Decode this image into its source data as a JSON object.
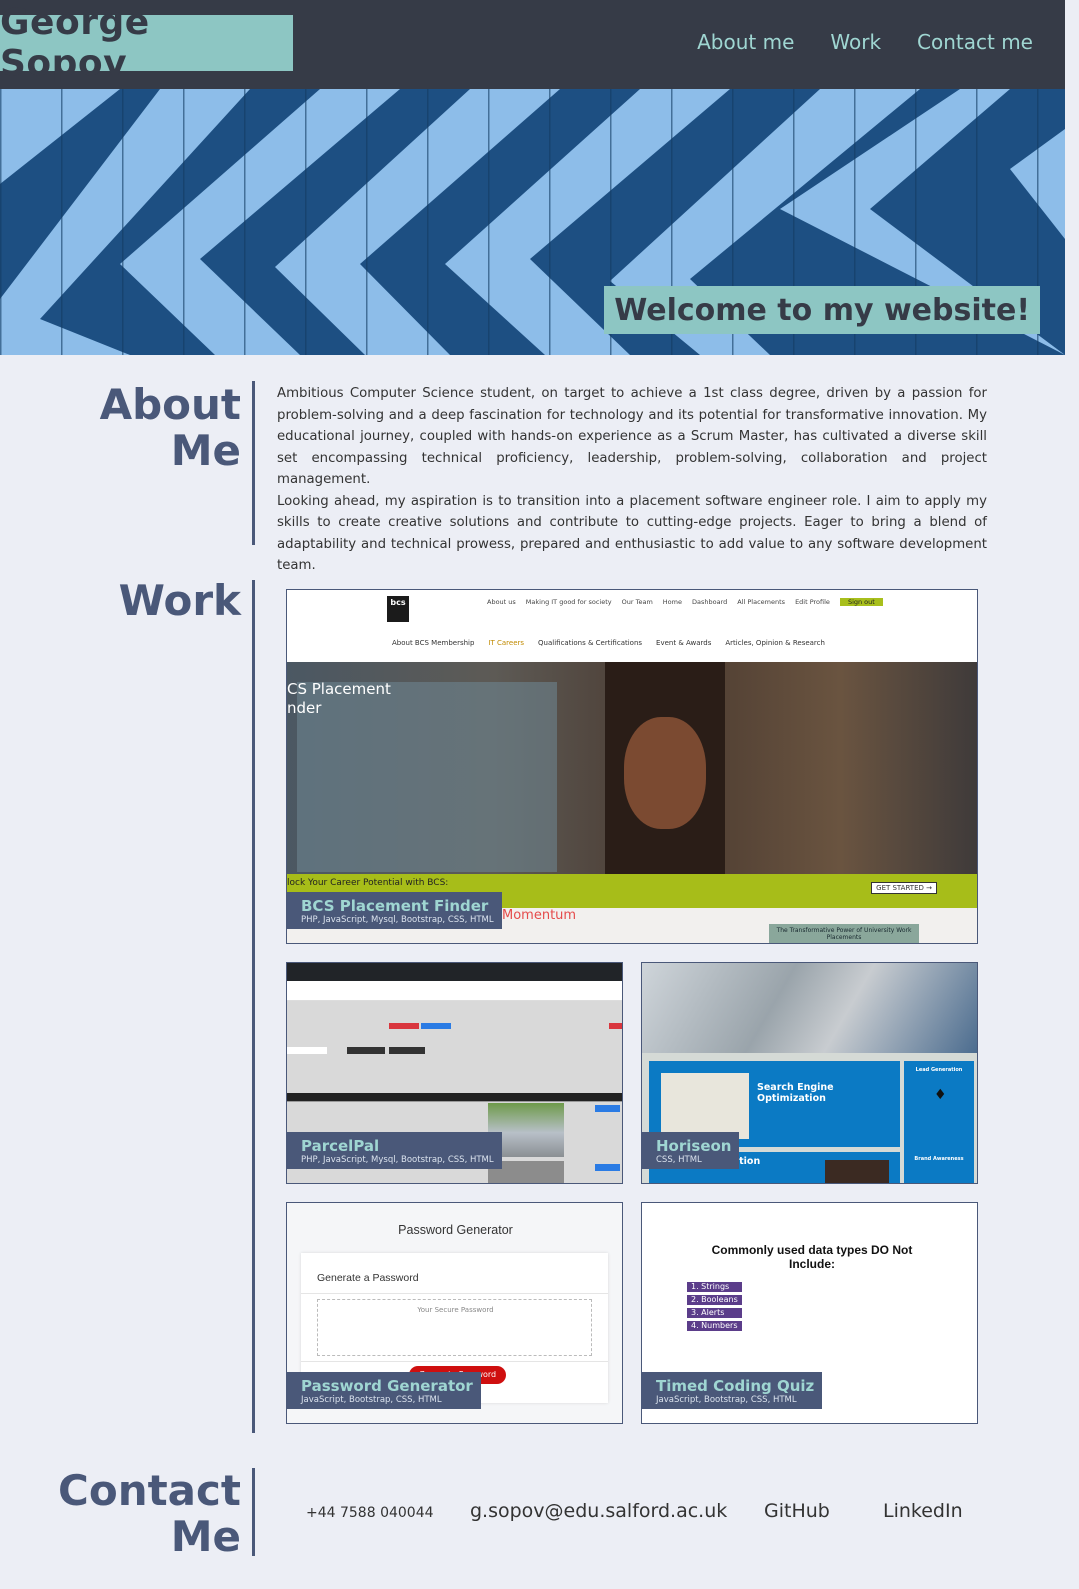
{
  "brand": "George Sopov",
  "nav": [
    "About me",
    "Work",
    "Contact me"
  ],
  "hero": {
    "welcome": "Welcome to my website!"
  },
  "about": {
    "title_line1": "About",
    "title_line2": "Me",
    "paragraph1": "Ambitious Computer Science student, on target to achieve a 1st class degree, driven by a passion for problem-solving and a deep fascination for technology and its potential for transformative innovation. My educational journey, coupled with hands-on experience as a Scrum Master, has cultivated a diverse skill set encompassing technical proficiency, leadership, problem-solving, collaboration and project management.",
    "paragraph2": "Looking ahead, my aspiration is to transition into a placement software engineer role. I aim to apply my skills to create creative solutions and contribute to cutting-edge projects. Eager to bring a blend of adaptability and technical prowess, prepared and enthusiastic to add value to any software development team."
  },
  "work": {
    "title": "Work",
    "projects": [
      {
        "title": "BCS Placement Finder",
        "tech": "PHP, JavaScript, Mysql, Bootstrap, CSS, HTML",
        "preview": {
          "logo": "bcs",
          "top_nav": [
            "About us",
            "Making IT good for society",
            "Our Team",
            "Home",
            "Dashboard",
            "All Placements",
            "Edit Profile",
            "Sign out"
          ],
          "sub_nav": [
            "About BCS Membership",
            "IT Careers",
            "Qualifications & Certifications",
            "Event & Awards",
            "Articles, Opinion & Research"
          ],
          "hero_line1": "CS Placement",
          "hero_line2": "nder",
          "banner": "lock Your Career Potential with BCS:",
          "cta": "GET STARTED →",
          "momentum_prefix": "r",
          "momentum": "Momentum",
          "footer_box": "The Transformative Power of University Work Placements"
        }
      },
      {
        "title": "ParcelPal",
        "tech": "PHP, JavaScript, Mysql, Bootstrap, CSS, HTML"
      },
      {
        "title": "Horiseon",
        "tech": "CSS, HTML",
        "preview": {
          "seo_title": "Search Engine Optimization",
          "lead_title": "Lead Generation",
          "brand_title": "Brand Awareness",
          "orm_title": "Online Reputation"
        }
      },
      {
        "title": "Password Generator",
        "tech": "JavaScript, Bootstrap, CSS, HTML",
        "preview": {
          "heading": "Password Generator",
          "subheading": "Generate a Password",
          "placeholder": "Your Secure Password",
          "button": "Generate Password"
        }
      },
      {
        "title": "Timed Coding Quiz",
        "tech": "JavaScript, Bootstrap, CSS, HTML",
        "preview": {
          "question": "Commonly used data types DO Not Include:",
          "options": [
            "1. Strings",
            "2. Booleans",
            "3. Alerts",
            "4. Numbers"
          ]
        }
      }
    ]
  },
  "contact": {
    "title_line1": "Contact",
    "title_line2": "Me",
    "phone": "+44 7588 040044",
    "email": "g.sopov@edu.salford.ac.uk",
    "github": "GitHub",
    "linkedin": "LinkedIn"
  }
}
